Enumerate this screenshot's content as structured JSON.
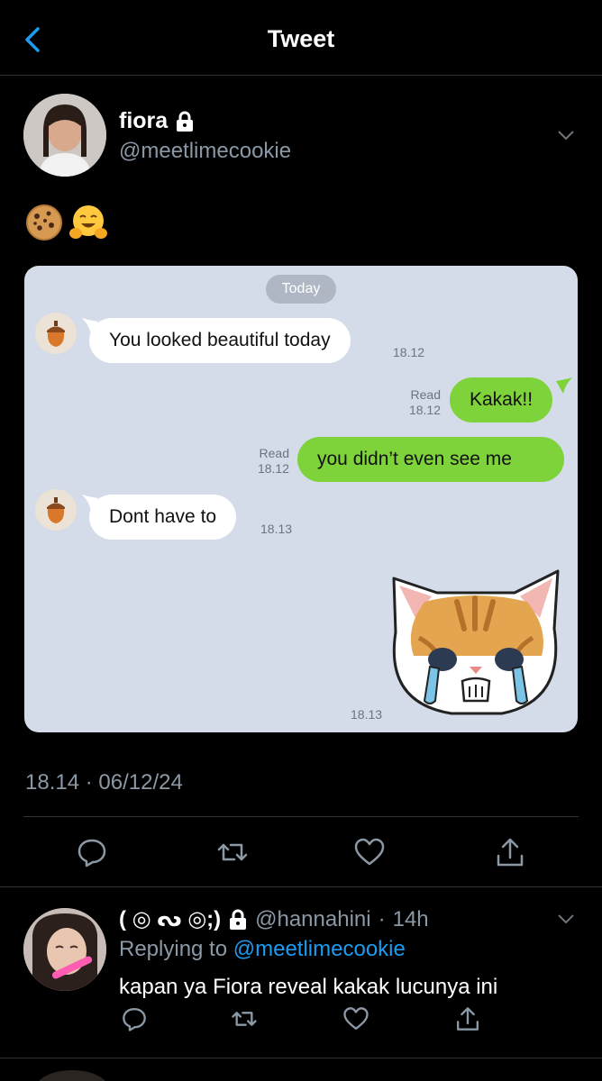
{
  "header": {
    "title": "Tweet",
    "back_icon": "chevron-left-icon"
  },
  "tweet": {
    "author_name": "fiora",
    "author_handle": "@meetlimecookie",
    "emojis": [
      "🍪",
      "🤗"
    ],
    "timestamp": "18.14 · 06/12/24",
    "media": {
      "date_pill": "Today",
      "messages": [
        {
          "side": "left",
          "text": "You looked beautiful today",
          "time": "18.12"
        },
        {
          "side": "right",
          "text": "Kakak!!",
          "read": "Read",
          "time": "18.12"
        },
        {
          "side": "right",
          "text": "you didn’t even see me",
          "read": "Read",
          "time": "18.12"
        },
        {
          "side": "left",
          "text": "Dont have to",
          "time": "18.13"
        },
        {
          "side": "left",
          "sticker": "crying-cat-sticker",
          "time": "18.13"
        }
      ]
    },
    "actions": [
      "reply-icon",
      "retweet-icon",
      "like-icon",
      "share-icon"
    ]
  },
  "reply": {
    "name": "( ◎ ᔓ ◎;)",
    "handle": "@hannahini",
    "time": "14h",
    "replying_label": "Replying to",
    "replying_to": "@meetlimecookie",
    "text": "kapan ya Fiora reveal kakak lucunya ini"
  },
  "colors": {
    "accent": "#1d9bf0",
    "line_green": "#7ed23a",
    "chat_bg": "#d3dce8",
    "muted": "#8b98a5"
  }
}
